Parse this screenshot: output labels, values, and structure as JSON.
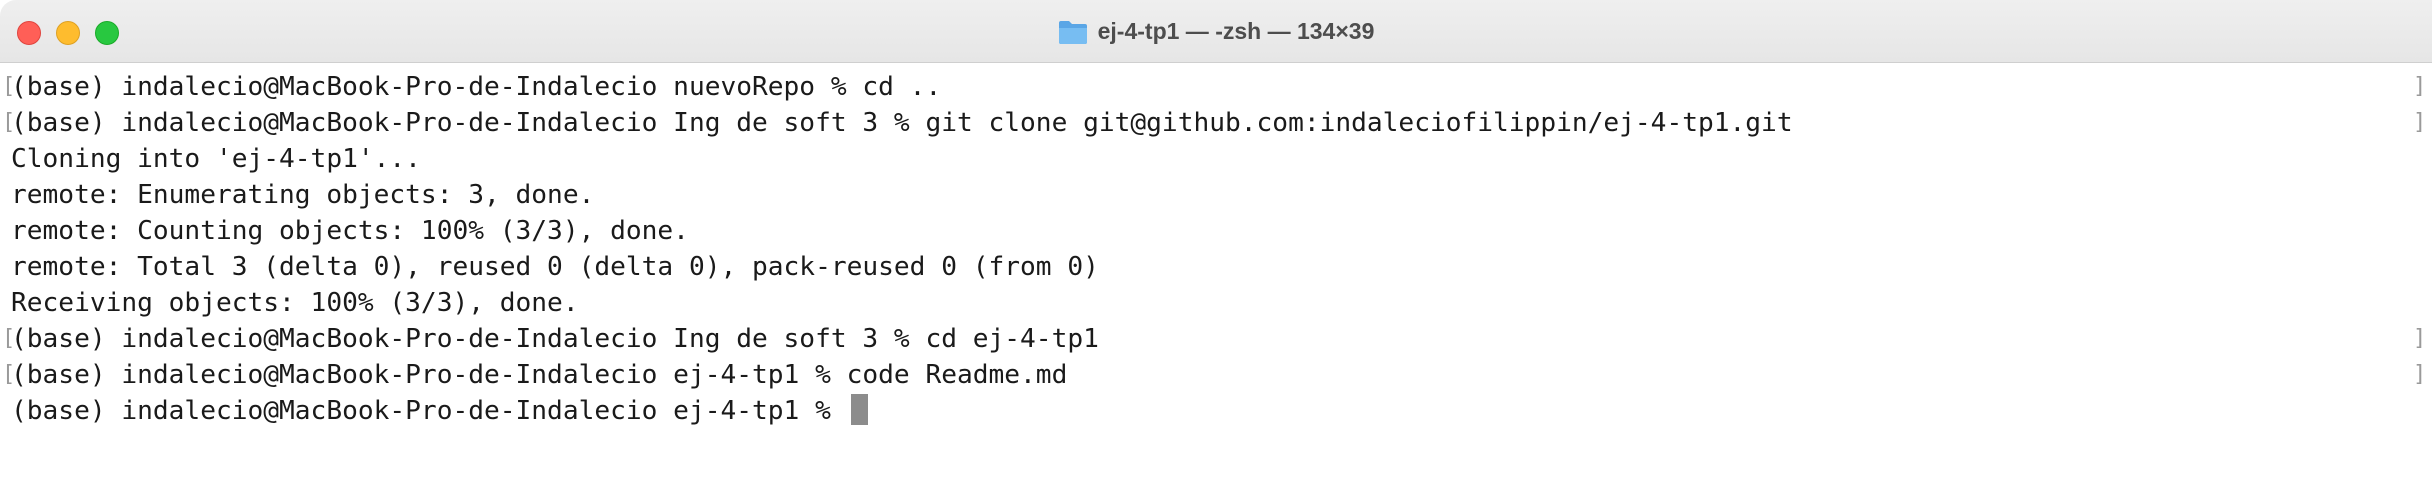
{
  "window": {
    "title": "ej-4-tp1 — -zsh — 134×39",
    "title_icon": "folder-icon",
    "traffic_lights": {
      "close": "#ff5f57",
      "minimize": "#febc2e",
      "maximize": "#28c840"
    }
  },
  "terminal": {
    "lines": [
      {
        "text": "(base) indalecio@MacBook-Pro-de-Indalecio nuevoRepo % cd ..",
        "marked": true
      },
      {
        "text": "(base) indalecio@MacBook-Pro-de-Indalecio Ing de soft 3 % git clone git@github.com:indaleciofilippin/ej-4-tp1.git",
        "marked": true
      },
      {
        "text": "Cloning into 'ej-4-tp1'...",
        "marked": false
      },
      {
        "text": "remote: Enumerating objects: 3, done.",
        "marked": false
      },
      {
        "text": "remote: Counting objects: 100% (3/3), done.",
        "marked": false
      },
      {
        "text": "remote: Total 3 (delta 0), reused 0 (delta 0), pack-reused 0 (from 0)",
        "marked": false
      },
      {
        "text": "Receiving objects: 100% (3/3), done.",
        "marked": false
      },
      {
        "text": "(base) indalecio@MacBook-Pro-de-Indalecio Ing de soft 3 % cd ej-4-tp1",
        "marked": true
      },
      {
        "text": "(base) indalecio@MacBook-Pro-de-Indalecio ej-4-tp1 % code Readme.md",
        "marked": true
      },
      {
        "text": "(base) indalecio@MacBook-Pro-de-Indalecio ej-4-tp1 % ",
        "marked": false,
        "cursor": true
      }
    ]
  }
}
